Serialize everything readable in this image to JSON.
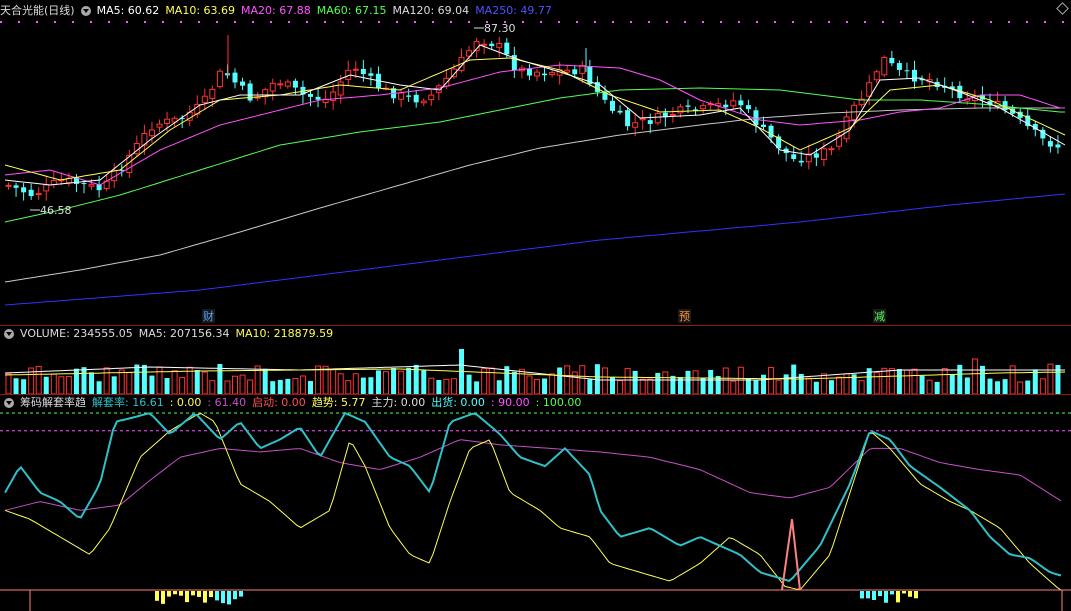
{
  "price_legend": {
    "name": "天合光能(日线)",
    "ma5": "MA5: 60.62",
    "ma10": "MA10: 63.69",
    "ma20": "MA20: 67.88",
    "ma60": "MA60: 67.15",
    "ma120": "MA120: 69.04",
    "ma250": "MA250: 49.77"
  },
  "price_annotations": {
    "high": "87.30",
    "low": "46.58",
    "event_cai": "财",
    "event_yu": "预",
    "event_jian": "减"
  },
  "volume_legend": {
    "volume": "VOLUME: 234555.05",
    "ma5": "MA5: 207156.34",
    "ma10": "MA10: 218879.59"
  },
  "indicator_legend": {
    "name": "筹码解套率趋",
    "jietao_label": "解套率: 16.61",
    "v0": ": 0.00",
    "v1": ": 61.40",
    "qidong": "启动: 0.00",
    "qushi": "趋势: 5.77",
    "zhuli": "主力: 0.00",
    "chuhuo": "出货: 0.00",
    "v90": ": 90.00",
    "v100": ": 100.00"
  },
  "colors": {
    "up": "#ff3232",
    "down": "#54ffff",
    "ma5": "#ffffff",
    "ma10": "#ffff54",
    "ma20": "#ff54ff",
    "ma60": "#54ff54",
    "ma120": "#c8c8c8",
    "ma250": "#3232ff",
    "jietao": "#2fc0c8",
    "trend": "#ffff54",
    "power": "#c850c8",
    "start": "#ff8080"
  },
  "chart_data": [
    {
      "type": "candlestick",
      "title": "天合光能(日线)",
      "ylim": [
        20,
        95
      ],
      "high_marker": 87.3,
      "low_marker": 46.58,
      "series": [
        {
          "name": "MA5",
          "value": 60.62
        },
        {
          "name": "MA10",
          "value": 63.69
        },
        {
          "name": "MA20",
          "value": 67.88
        },
        {
          "name": "MA60",
          "value": 67.15
        },
        {
          "name": "MA120",
          "value": 69.04
        },
        {
          "name": "MA250",
          "value": 49.77
        }
      ]
    },
    {
      "type": "bar",
      "title": "VOLUME",
      "last_value": 234555.05,
      "series": [
        {
          "name": "MA5",
          "value": 207156.34
        },
        {
          "name": "MA10",
          "value": 218879.59
        }
      ]
    },
    {
      "type": "line",
      "title": "筹码解套率趋",
      "ylim": [
        0,
        100
      ],
      "reference_lines": [
        90,
        100
      ],
      "series": [
        {
          "name": "解套率",
          "value": 16.61
        },
        {
          "name": "趋势",
          "value": 5.77
        },
        {
          "name": "主力",
          "value": 0.0
        },
        {
          "name": "启动",
          "value": 0.0
        },
        {
          "name": "出货",
          "value": 0.0
        }
      ]
    }
  ]
}
